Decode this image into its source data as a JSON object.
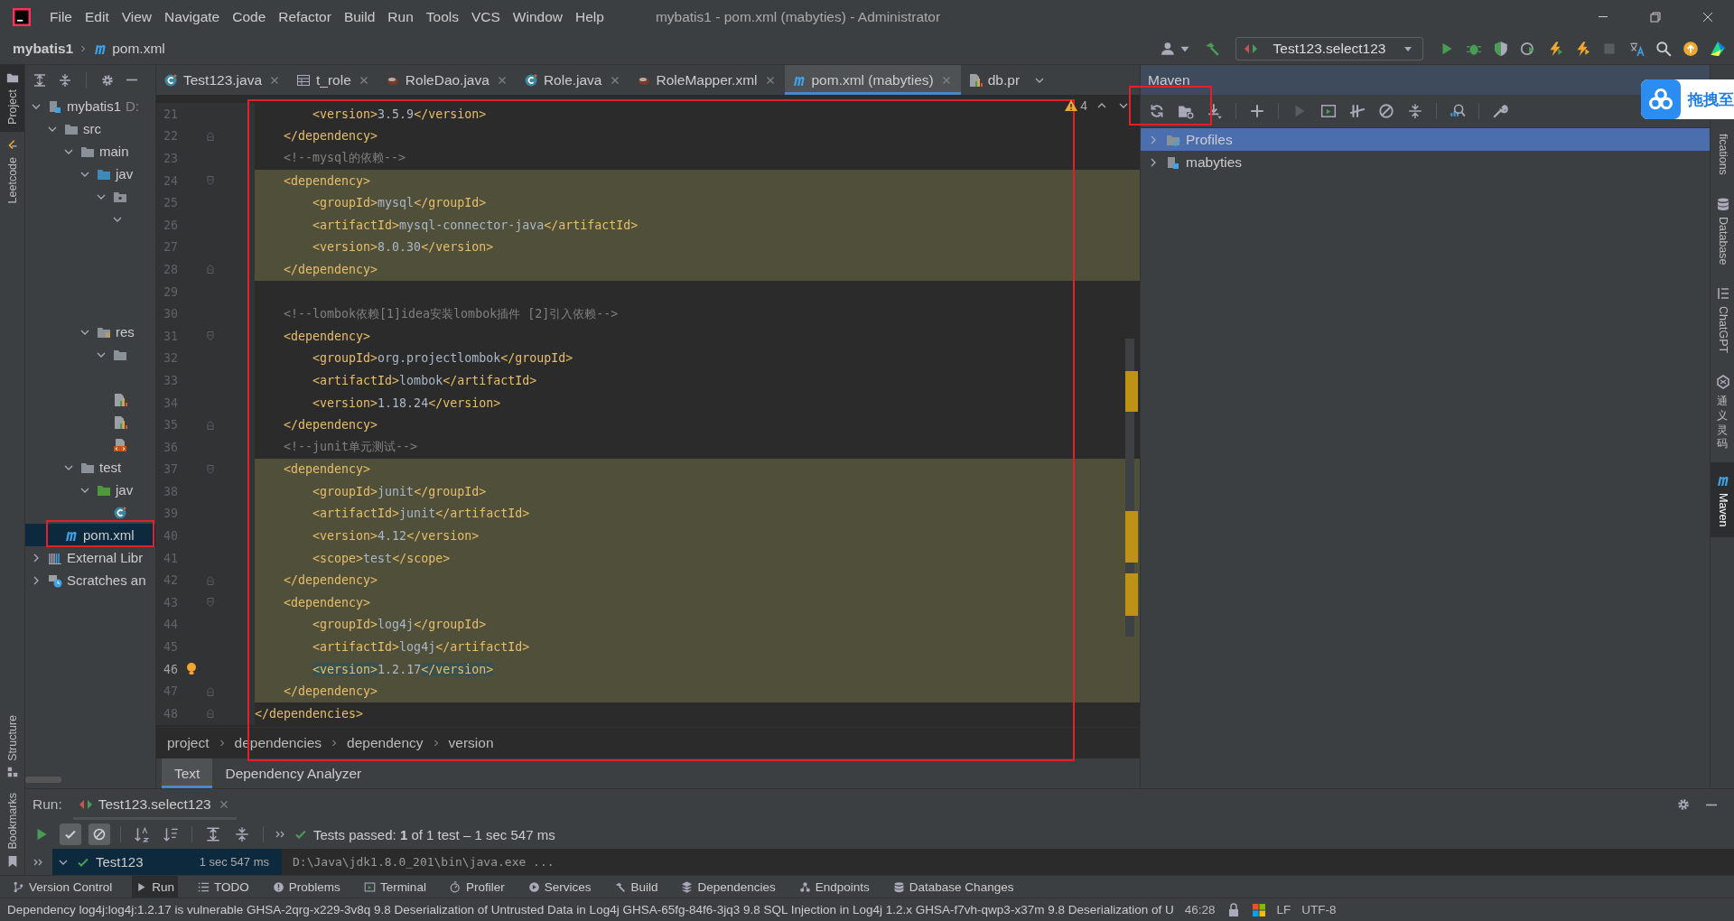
{
  "window": {
    "title": "mybatis1 - pom.xml (mabyties) - Administrator"
  },
  "menu": [
    "File",
    "Edit",
    "View",
    "Navigate",
    "Code",
    "Refactor",
    "Build",
    "Run",
    "Tools",
    "VCS",
    "Window",
    "Help"
  ],
  "nav_path": [
    "mybatis1",
    "pom.xml"
  ],
  "run_config": "Test123.select123",
  "left_strip_top": [
    {
      "label": "Project",
      "kind": "project",
      "selected": true
    },
    {
      "label": "Leetcode",
      "kind": "leetcode",
      "selected": false
    }
  ],
  "left_strip_bottom": [
    {
      "label": "Structure",
      "kind": "structure",
      "selected": false
    },
    {
      "label": "Bookmarks",
      "kind": "bookmarks",
      "selected": false
    }
  ],
  "project_tree": [
    {
      "label": "mybatis1",
      "note": "D:",
      "kind": "module",
      "expanded": true,
      "selected": false,
      "children": [
        {
          "label": "src",
          "kind": "folder",
          "expanded": true,
          "selected": false,
          "children": [
            {
              "label": "main",
              "kind": "folder",
              "expanded": true,
              "selected": false,
              "children": [
                {
                  "label": "jav",
                  "kind": "source-folder",
                  "expanded": true,
                  "selected": false,
                  "children": [
                    {
                      "kind": "package",
                      "expanded": true,
                      "selected": false,
                      "children": [
                        {
                          "kind": "blank",
                          "expanded": true,
                          "selected": false,
                          "children": [
                            {
                              "kind": "blank"
                            },
                            {
                              "kind": "blank"
                            },
                            {
                              "kind": "blank"
                            },
                            {
                              "kind": "blank"
                            }
                          ]
                        }
                      ]
                    }
                  ]
                },
                {
                  "label": "res",
                  "kind": "resource-folder",
                  "expanded": true,
                  "selected": false,
                  "children": [
                    {
                      "kind": "folder",
                      "expanded": true,
                      "selected": false,
                      "children": [
                        {
                          "kind": "blank"
                        }
                      ]
                    },
                    {
                      "kind": "chart-file",
                      "selected": false
                    },
                    {
                      "kind": "chart-file",
                      "selected": false
                    },
                    {
                      "kind": "xml-file",
                      "selected": false
                    }
                  ]
                }
              ]
            },
            {
              "label": "test",
              "kind": "folder",
              "expanded": true,
              "selected": false,
              "children": [
                {
                  "label": "jav",
                  "kind": "test-folder",
                  "expanded": true,
                  "selected": false,
                  "children": [
                    {
                      "kind": "class-file",
                      "selected": false
                    }
                  ]
                }
              ]
            }
          ]
        },
        {
          "label": "pom.xml",
          "kind": "maven-file",
          "selected": true
        }
      ]
    },
    {
      "label": "External Libr",
      "kind": "libraries",
      "expanded": false,
      "selected": false
    },
    {
      "label": "Scratches an",
      "kind": "scratches",
      "expanded": false,
      "selected": false
    }
  ],
  "editor_tabs": [
    {
      "label": "Test123.java",
      "kind": "class",
      "closable": true,
      "selected": false
    },
    {
      "label": "t_role",
      "kind": "table",
      "closable": true,
      "selected": false
    },
    {
      "label": "RoleDao.java",
      "kind": "bean",
      "closable": true,
      "selected": false
    },
    {
      "label": "Role.java",
      "kind": "class",
      "closable": true,
      "selected": false
    },
    {
      "label": "RoleMapper.xml",
      "kind": "bean",
      "closable": true,
      "selected": false
    },
    {
      "label": "pom.xml (mabyties)",
      "kind": "maven",
      "closable": true,
      "selected": true
    },
    {
      "label": "db.pr",
      "kind": "chart",
      "closable": false,
      "selected": false
    }
  ],
  "editor": {
    "warnings": "4",
    "lines": [
      {
        "number": "21",
        "fold_start": false,
        "fold_end": false,
        "highlighted": false,
        "current": false,
        "tokens": [
          {
            "kind": "tag",
            "text": "        <version>"
          },
          {
            "kind": "text",
            "text": "3.5.9"
          },
          {
            "kind": "tag",
            "text": "</version>"
          }
        ]
      },
      {
        "number": "22",
        "fold_start": false,
        "fold_end": true,
        "highlighted": false,
        "current": false,
        "tokens": [
          {
            "kind": "tag",
            "text": "    </dependency>"
          }
        ]
      },
      {
        "number": "23",
        "fold_start": false,
        "fold_end": false,
        "highlighted": false,
        "current": false,
        "tokens": [
          {
            "kind": "comment",
            "text": "    <!--mysql的依赖-->"
          }
        ]
      },
      {
        "number": "24",
        "fold_start": true,
        "fold_end": false,
        "highlighted": true,
        "current": false,
        "tokens": [
          {
            "kind": "tag",
            "text": "    <dependency>"
          }
        ]
      },
      {
        "number": "25",
        "fold_start": false,
        "fold_end": false,
        "highlighted": true,
        "current": false,
        "tokens": [
          {
            "kind": "tag",
            "text": "        <groupId>"
          },
          {
            "kind": "text",
            "text": "mysql"
          },
          {
            "kind": "tag",
            "text": "</groupId>"
          }
        ]
      },
      {
        "number": "26",
        "fold_start": false,
        "fold_end": false,
        "highlighted": true,
        "current": false,
        "tokens": [
          {
            "kind": "tag",
            "text": "        <artifactId>"
          },
          {
            "kind": "text",
            "text": "mysql-connector-java"
          },
          {
            "kind": "tag",
            "text": "</artifactId>"
          }
        ]
      },
      {
        "number": "27",
        "fold_start": false,
        "fold_end": false,
        "highlighted": true,
        "current": false,
        "tokens": [
          {
            "kind": "tag",
            "text": "        <version>"
          },
          {
            "kind": "text",
            "text": "8.0.30"
          },
          {
            "kind": "tag",
            "text": "</version>"
          }
        ]
      },
      {
        "number": "28",
        "fold_start": false,
        "fold_end": true,
        "highlighted": true,
        "current": false,
        "tokens": [
          {
            "kind": "tag",
            "text": "    </dependency>"
          }
        ]
      },
      {
        "number": "29",
        "fold_start": false,
        "fold_end": false,
        "highlighted": false,
        "current": false
      },
      {
        "number": "30",
        "fold_start": false,
        "fold_end": false,
        "highlighted": false,
        "current": false,
        "tokens": [
          {
            "kind": "comment",
            "text": "    <!--lombok依赖[1]idea安装lombok插件 [2]引入依赖-->"
          }
        ]
      },
      {
        "number": "31",
        "fold_start": true,
        "fold_end": false,
        "highlighted": false,
        "current": false,
        "tokens": [
          {
            "kind": "tag",
            "text": "    <dependency>"
          }
        ]
      },
      {
        "number": "32",
        "fold_start": false,
        "fold_end": false,
        "highlighted": false,
        "current": false,
        "tokens": [
          {
            "kind": "tag",
            "text": "        <groupId>"
          },
          {
            "kind": "text",
            "text": "org.projectlombok"
          },
          {
            "kind": "tag",
            "text": "</groupId>"
          }
        ]
      },
      {
        "number": "33",
        "fold_start": false,
        "fold_end": false,
        "highlighted": false,
        "current": false,
        "tokens": [
          {
            "kind": "tag",
            "text": "        <artifactId>"
          },
          {
            "kind": "text",
            "text": "lombok"
          },
          {
            "kind": "tag",
            "text": "</artifactId>"
          }
        ]
      },
      {
        "number": "34",
        "fold_start": false,
        "fold_end": false,
        "highlighted": false,
        "current": false,
        "tokens": [
          {
            "kind": "tag",
            "text": "        <version>"
          },
          {
            "kind": "text",
            "text": "1.18.24"
          },
          {
            "kind": "tag",
            "text": "</version>"
          }
        ]
      },
      {
        "number": "35",
        "fold_start": false,
        "fold_end": true,
        "highlighted": false,
        "current": false,
        "tokens": [
          {
            "kind": "tag",
            "text": "    </dependency>"
          }
        ]
      },
      {
        "number": "36",
        "fold_start": false,
        "fold_end": false,
        "highlighted": false,
        "current": false,
        "tokens": [
          {
            "kind": "comment",
            "text": "    <!--junit单元测试-->"
          }
        ]
      },
      {
        "number": "37",
        "fold_start": true,
        "fold_end": false,
        "highlighted": true,
        "current": false,
        "tokens": [
          {
            "kind": "tag",
            "text": "    <dependency>"
          }
        ]
      },
      {
        "number": "38",
        "fold_start": false,
        "fold_end": false,
        "highlighted": true,
        "current": false,
        "tokens": [
          {
            "kind": "tag",
            "text": "        <groupId>"
          },
          {
            "kind": "text",
            "text": "junit"
          },
          {
            "kind": "tag",
            "text": "</groupId>"
          }
        ]
      },
      {
        "number": "39",
        "fold_start": false,
        "fold_end": false,
        "highlighted": true,
        "current": false,
        "tokens": [
          {
            "kind": "tag",
            "text": "        <artifactId>"
          },
          {
            "kind": "text",
            "text": "junit"
          },
          {
            "kind": "tag",
            "text": "</artifactId>"
          }
        ]
      },
      {
        "number": "40",
        "fold_start": false,
        "fold_end": false,
        "highlighted": true,
        "current": false,
        "tokens": [
          {
            "kind": "tag",
            "text": "        <version>"
          },
          {
            "kind": "text",
            "text": "4.12"
          },
          {
            "kind": "tag",
            "text": "</version>"
          }
        ]
      },
      {
        "number": "41",
        "fold_start": false,
        "fold_end": false,
        "highlighted": true,
        "current": false,
        "tokens": [
          {
            "kind": "tag",
            "text": "        <scope>"
          },
          {
            "kind": "text",
            "text": "test"
          },
          {
            "kind": "tag",
            "text": "</scope>"
          }
        ]
      },
      {
        "number": "42",
        "fold_start": false,
        "fold_end": true,
        "highlighted": true,
        "current": false,
        "tokens": [
          {
            "kind": "tag",
            "text": "    </dependency>"
          }
        ]
      },
      {
        "number": "43",
        "fold_start": true,
        "fold_end": false,
        "highlighted": true,
        "current": false,
        "tokens": [
          {
            "kind": "tag",
            "text": "    <dependency>"
          }
        ]
      },
      {
        "number": "44",
        "fold_start": false,
        "fold_end": false,
        "highlighted": true,
        "current": false,
        "tokens": [
          {
            "kind": "tag",
            "text": "        <groupId>"
          },
          {
            "kind": "text",
            "text": "log4j"
          },
          {
            "kind": "tag",
            "text": "</groupId>"
          }
        ]
      },
      {
        "number": "45",
        "fold_start": false,
        "fold_end": false,
        "highlighted": true,
        "current": false,
        "tokens": [
          {
            "kind": "tag",
            "text": "        <artifactId>"
          },
          {
            "kind": "text",
            "text": "log4j"
          },
          {
            "kind": "tag",
            "text": "</artifactId>"
          }
        ]
      },
      {
        "number": "46",
        "fold_start": false,
        "fold_end": false,
        "highlighted": true,
        "current": true,
        "tokens": [
          {
            "kind": "matched-tag",
            "text": "        <version>"
          },
          {
            "kind": "text",
            "text": "1.2.17"
          },
          {
            "kind": "matched-tag",
            "text": "</version>"
          }
        ]
      },
      {
        "number": "47",
        "fold_start": false,
        "fold_end": true,
        "highlighted": true,
        "current": false,
        "tokens": [
          {
            "kind": "tag",
            "text": "    </dependency>"
          }
        ]
      },
      {
        "number": "48",
        "fold_start": false,
        "fold_end": true,
        "highlighted": false,
        "current": false,
        "tokens": [
          {
            "kind": "tag",
            "text": "</dependencies>"
          }
        ]
      }
    ],
    "breadcrumbs": [
      "project",
      "dependencies",
      "dependency",
      "version"
    ],
    "bottom_tabs": [
      {
        "label": "Text",
        "selected": true
      },
      {
        "label": "Dependency Analyzer",
        "selected": false
      }
    ]
  },
  "maven": {
    "title": "Maven",
    "tree": [
      {
        "label": "Profiles",
        "kind": "profiles",
        "selected": true
      },
      {
        "label": "mabyties",
        "kind": "module",
        "selected": false
      }
    ]
  },
  "drag_widget": {
    "label": "拖拽至"
  },
  "right_strip": [
    {
      "label": "fications",
      "kind": "plain",
      "selected": false
    },
    {
      "label": "Database",
      "kind": "database",
      "selected": false
    },
    {
      "label": "ChatGPT",
      "kind": "chatgpt",
      "selected": false
    },
    {
      "label": "通义灵码",
      "kind": "tongyi",
      "selected": false
    },
    {
      "label": "Maven",
      "kind": "maven",
      "selected": true
    }
  ],
  "run": {
    "label": "Run:",
    "tab": "Test123.select123",
    "toggles": [
      {
        "kind": "passed",
        "selected": true
      },
      {
        "kind": "ignored",
        "selected": true
      }
    ],
    "summary": "Tests passed: **1** of 1 test – 1 sec 547 ms",
    "test": {
      "name": "Test123",
      "time": "1 sec 547 ms",
      "passed": true,
      "expanded": true
    },
    "console": "D:\\Java\\jdk1.8.0_201\\bin\\java.exe ..."
  },
  "tool_windows": [
    {
      "label": "Version Control",
      "kind": "vcs",
      "selected": false
    },
    {
      "label": "Run",
      "kind": "run",
      "selected": true
    },
    {
      "label": "TODO",
      "kind": "todo",
      "selected": false
    },
    {
      "label": "Problems",
      "kind": "problems",
      "selected": false
    },
    {
      "label": "Terminal",
      "kind": "terminal",
      "selected": false
    },
    {
      "label": "Profiler",
      "kind": "profiler",
      "selected": false
    },
    {
      "label": "Services",
      "kind": "services",
      "selected": false
    },
    {
      "label": "Build",
      "kind": "build",
      "selected": false
    },
    {
      "label": "Dependencies",
      "kind": "dependencies",
      "selected": false
    },
    {
      "label": "Endpoints",
      "kind": "endpoints",
      "selected": false
    },
    {
      "label": "Database Changes",
      "kind": "dbchanges",
      "selected": false
    }
  ],
  "status_bar": {
    "message": "Dependency log4j:log4j:1.2.17 is vulnerable GHSA-2qrg-x229-3v8q 9.8 Deserialization of Untrusted Data in Log4j GHSA-65fg-84f6-3jq3 9.8 SQL Injection in Log4j 1.2.x GHSA-f7vh-qwp3-x37m 9.8 Deserialization of U",
    "position": "46:28",
    "line_ending": "LF",
    "encoding": "UTF-8"
  }
}
